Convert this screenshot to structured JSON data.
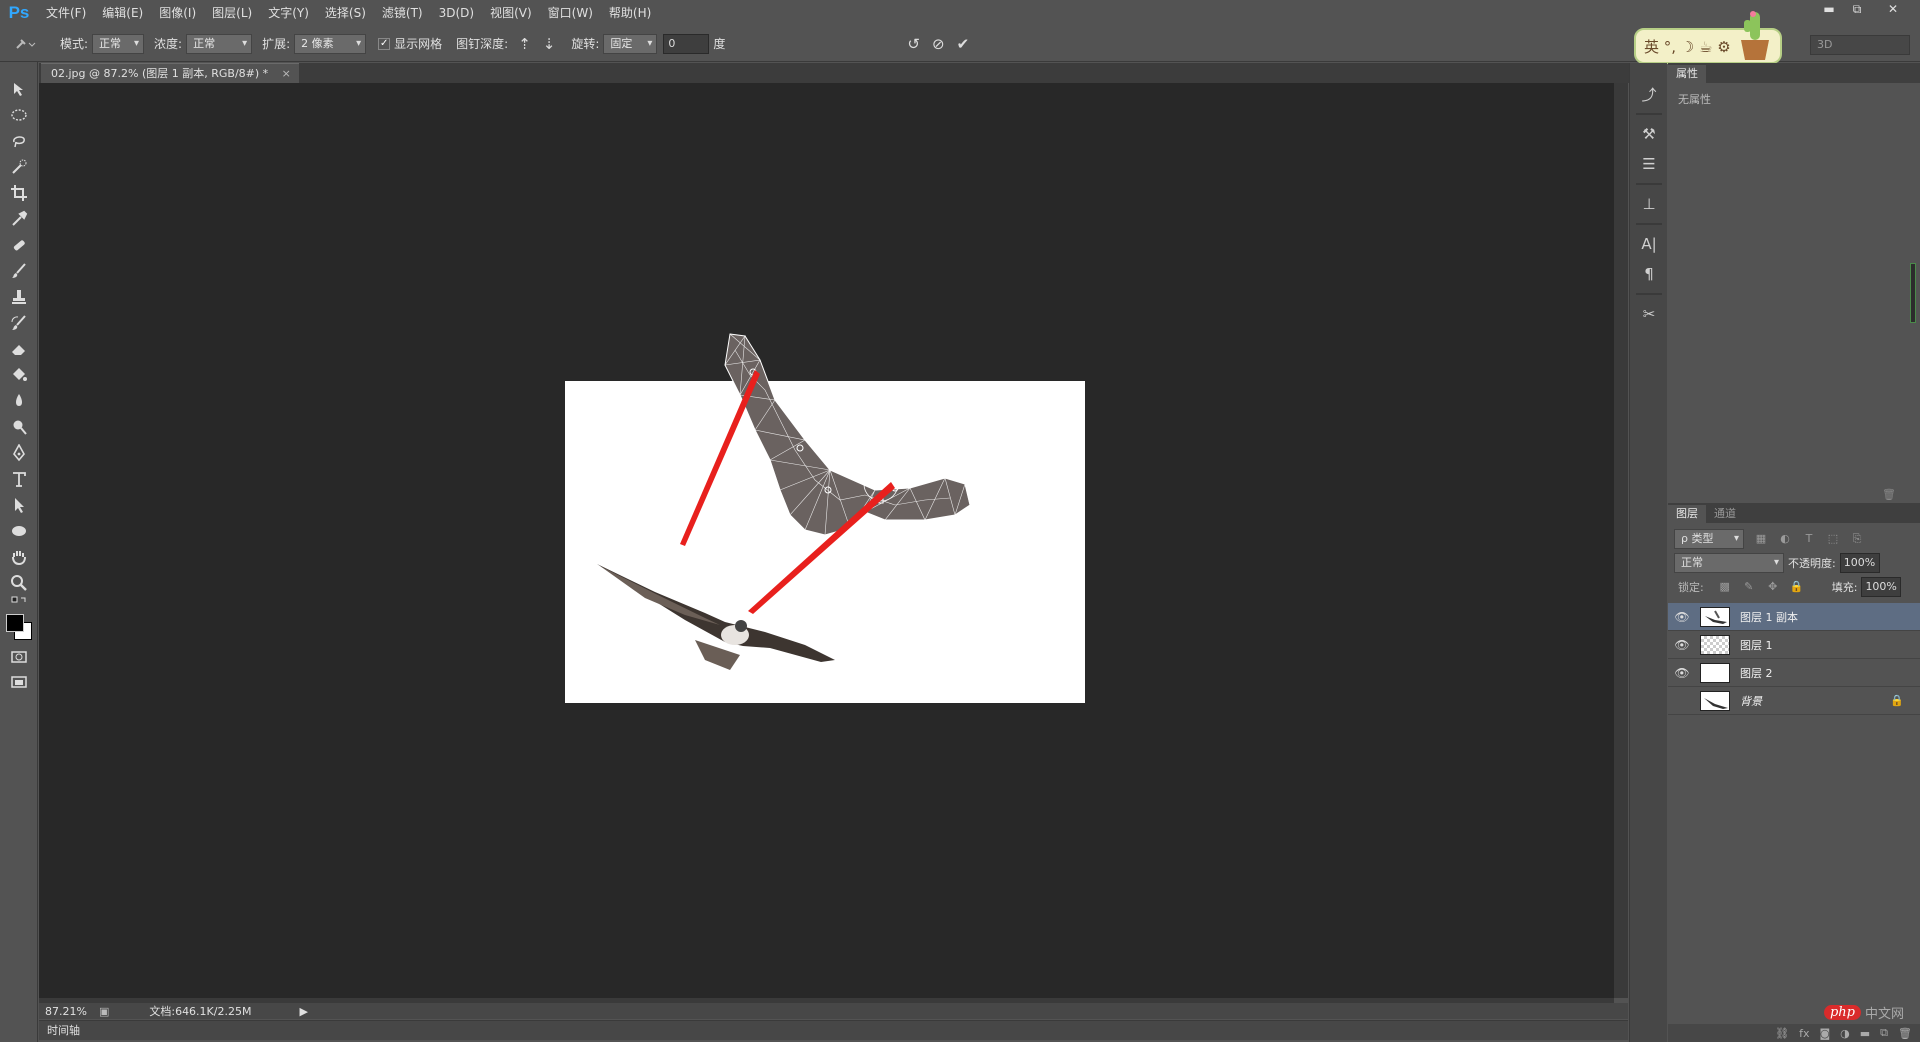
{
  "app": {
    "logo": "Ps"
  },
  "menu": [
    "文件(F)",
    "编辑(E)",
    "图像(I)",
    "图层(L)",
    "文字(Y)",
    "选择(S)",
    "滤镜(T)",
    "3D(D)",
    "视图(V)",
    "窗口(W)",
    "帮助(H)"
  ],
  "window_controls": {
    "minimize": "▬",
    "restore": "⧉",
    "close": "✕"
  },
  "options": {
    "mode_label": "模式:",
    "mode_value": "正常",
    "density_label": "浓度:",
    "density_value": "正常",
    "expand_label": "扩展:",
    "expand_value": "2 像素",
    "show_mesh_label": "显示网格",
    "show_mesh_checked": true,
    "pin_depth_label": "图钉深度:",
    "rotate_label": "旋转:",
    "rotate_value": "固定",
    "angle_value": "0",
    "angle_unit": "度"
  },
  "ime": {
    "text": "英 °, ☽ ☕ ⚙"
  },
  "workspace": {
    "value": "3D"
  },
  "document": {
    "tab_title": "02.jpg @ 87.2% (图层 1 副本, RGB/8#) *",
    "close": "×"
  },
  "status": {
    "zoom": "87.21%",
    "doc_info": "文档:646.1K/2.25M"
  },
  "timeline": {
    "label": "时间轴"
  },
  "properties": {
    "tab": "属性",
    "empty_text": "无属性"
  },
  "layers_panel": {
    "tabs": [
      "图层",
      "通道"
    ],
    "filter_label": "ρ 类型",
    "blend_mode": "正常",
    "opacity_label": "不透明度:",
    "opacity_value": "100%",
    "lock_label": "锁定:",
    "fill_label": "填充:",
    "fill_value": "100%",
    "layers": [
      {
        "name": "图层 1 副本",
        "visible": true,
        "selected": true,
        "thumb": "bird"
      },
      {
        "name": "图层 1",
        "visible": true,
        "selected": false,
        "thumb": "checker"
      },
      {
        "name": "图层 2",
        "visible": true,
        "selected": false,
        "thumb": "white"
      },
      {
        "name": "背景",
        "visible": false,
        "selected": false,
        "thumb": "bird",
        "locked": true
      }
    ],
    "footer_icons": [
      "link-icon",
      "fx-icon",
      "mask-icon",
      "adjustment-icon",
      "group-icon",
      "new-layer-icon",
      "trash-icon"
    ]
  },
  "watermark": {
    "logo": "php",
    "text": "中文网"
  }
}
